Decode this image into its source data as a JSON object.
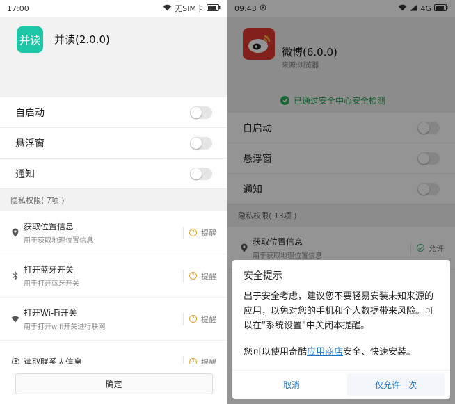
{
  "left": {
    "status": {
      "time": "17:00",
      "carrier": "无SIM卡"
    },
    "app": {
      "icon_text": "并读",
      "title": "并读(2.0.0)",
      "icon_color": "#1ec6a8"
    },
    "toggles": [
      {
        "label": "自启动"
      },
      {
        "label": "悬浮窗"
      },
      {
        "label": "通知"
      }
    ],
    "privacy_title": "隐私权限( 7项 )",
    "permissions": [
      {
        "icon": "location-pin-icon",
        "title": "获取位置信息",
        "desc": "用于获取地理位置信息",
        "action": "提醒"
      },
      {
        "icon": "bluetooth-icon",
        "title": "打开蓝牙开关",
        "desc": "用于打开蓝牙开关",
        "action": "提醒"
      },
      {
        "icon": "wifi-icon",
        "title": "打开Wi-Fi开关",
        "desc": "用于打开wifi开关进行联网",
        "action": "提醒"
      },
      {
        "icon": "contact-icon",
        "title": "读取联系人信息",
        "desc": "",
        "action": "提醒"
      }
    ],
    "confirm_label": "确定"
  },
  "right": {
    "status": {
      "time": "09:43",
      "network": "4G"
    },
    "app": {
      "title": "微博(6.0.0)",
      "source": "来源:浏览器",
      "icon_color": "#e03a2f"
    },
    "safe_check": "已通过安全中心安全检测",
    "toggles": [
      {
        "label": "自启动"
      },
      {
        "label": "悬浮窗"
      },
      {
        "label": "通知"
      }
    ],
    "privacy_title": "隐私权限( 13项 )",
    "permissions": [
      {
        "icon": "location-pin-icon",
        "title": "获取位置信息",
        "desc": "用于获取地理位置信息",
        "action": "允许"
      }
    ],
    "dialog": {
      "title": "安全提示",
      "body": "出于安全考虑，建议您不要轻易安装未知来源的应用，以免对您的手机和个人数据带来风险。可以在\"系统设置\"中关闭本提醒。",
      "body2_prefix": "您可以使用奇酷",
      "body2_link": "应用商店",
      "body2_suffix": "安全、快速安装。",
      "cancel_label": "取消",
      "allow_label": "仅允许一次"
    }
  }
}
